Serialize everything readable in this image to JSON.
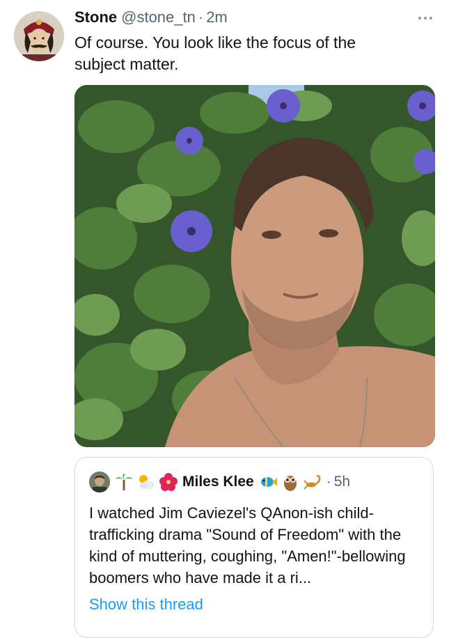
{
  "tweet": {
    "author_name": "Stone",
    "author_handle": "@stone_tn",
    "separator": "·",
    "time": "2m",
    "text": "Of course. You look like the focus of the subject matter."
  },
  "quoted_tweet": {
    "author_name": "Miles Klee",
    "separator": "·",
    "time": "5h",
    "name_prefix_icons": [
      "palm-tree-icon",
      "sun-behind-cloud-icon",
      "hibiscus-icon"
    ],
    "name_suffix_icons": [
      "tropical-fish-icon",
      "owl-icon",
      "scorpion-icon"
    ],
    "text": "I watched Jim Caviezel's QAnon-ish child-trafficking drama \"Sound of Freedom\" with the kind of muttering, coughing, \"Amen!\"-bellowing boomers who have made it a ri...",
    "show_thread_label": "Show this thread"
  },
  "colors": {
    "text_primary": "#0f1419",
    "text_secondary": "#536471",
    "link": "#1d9bf0",
    "border": "#cfd9de"
  }
}
